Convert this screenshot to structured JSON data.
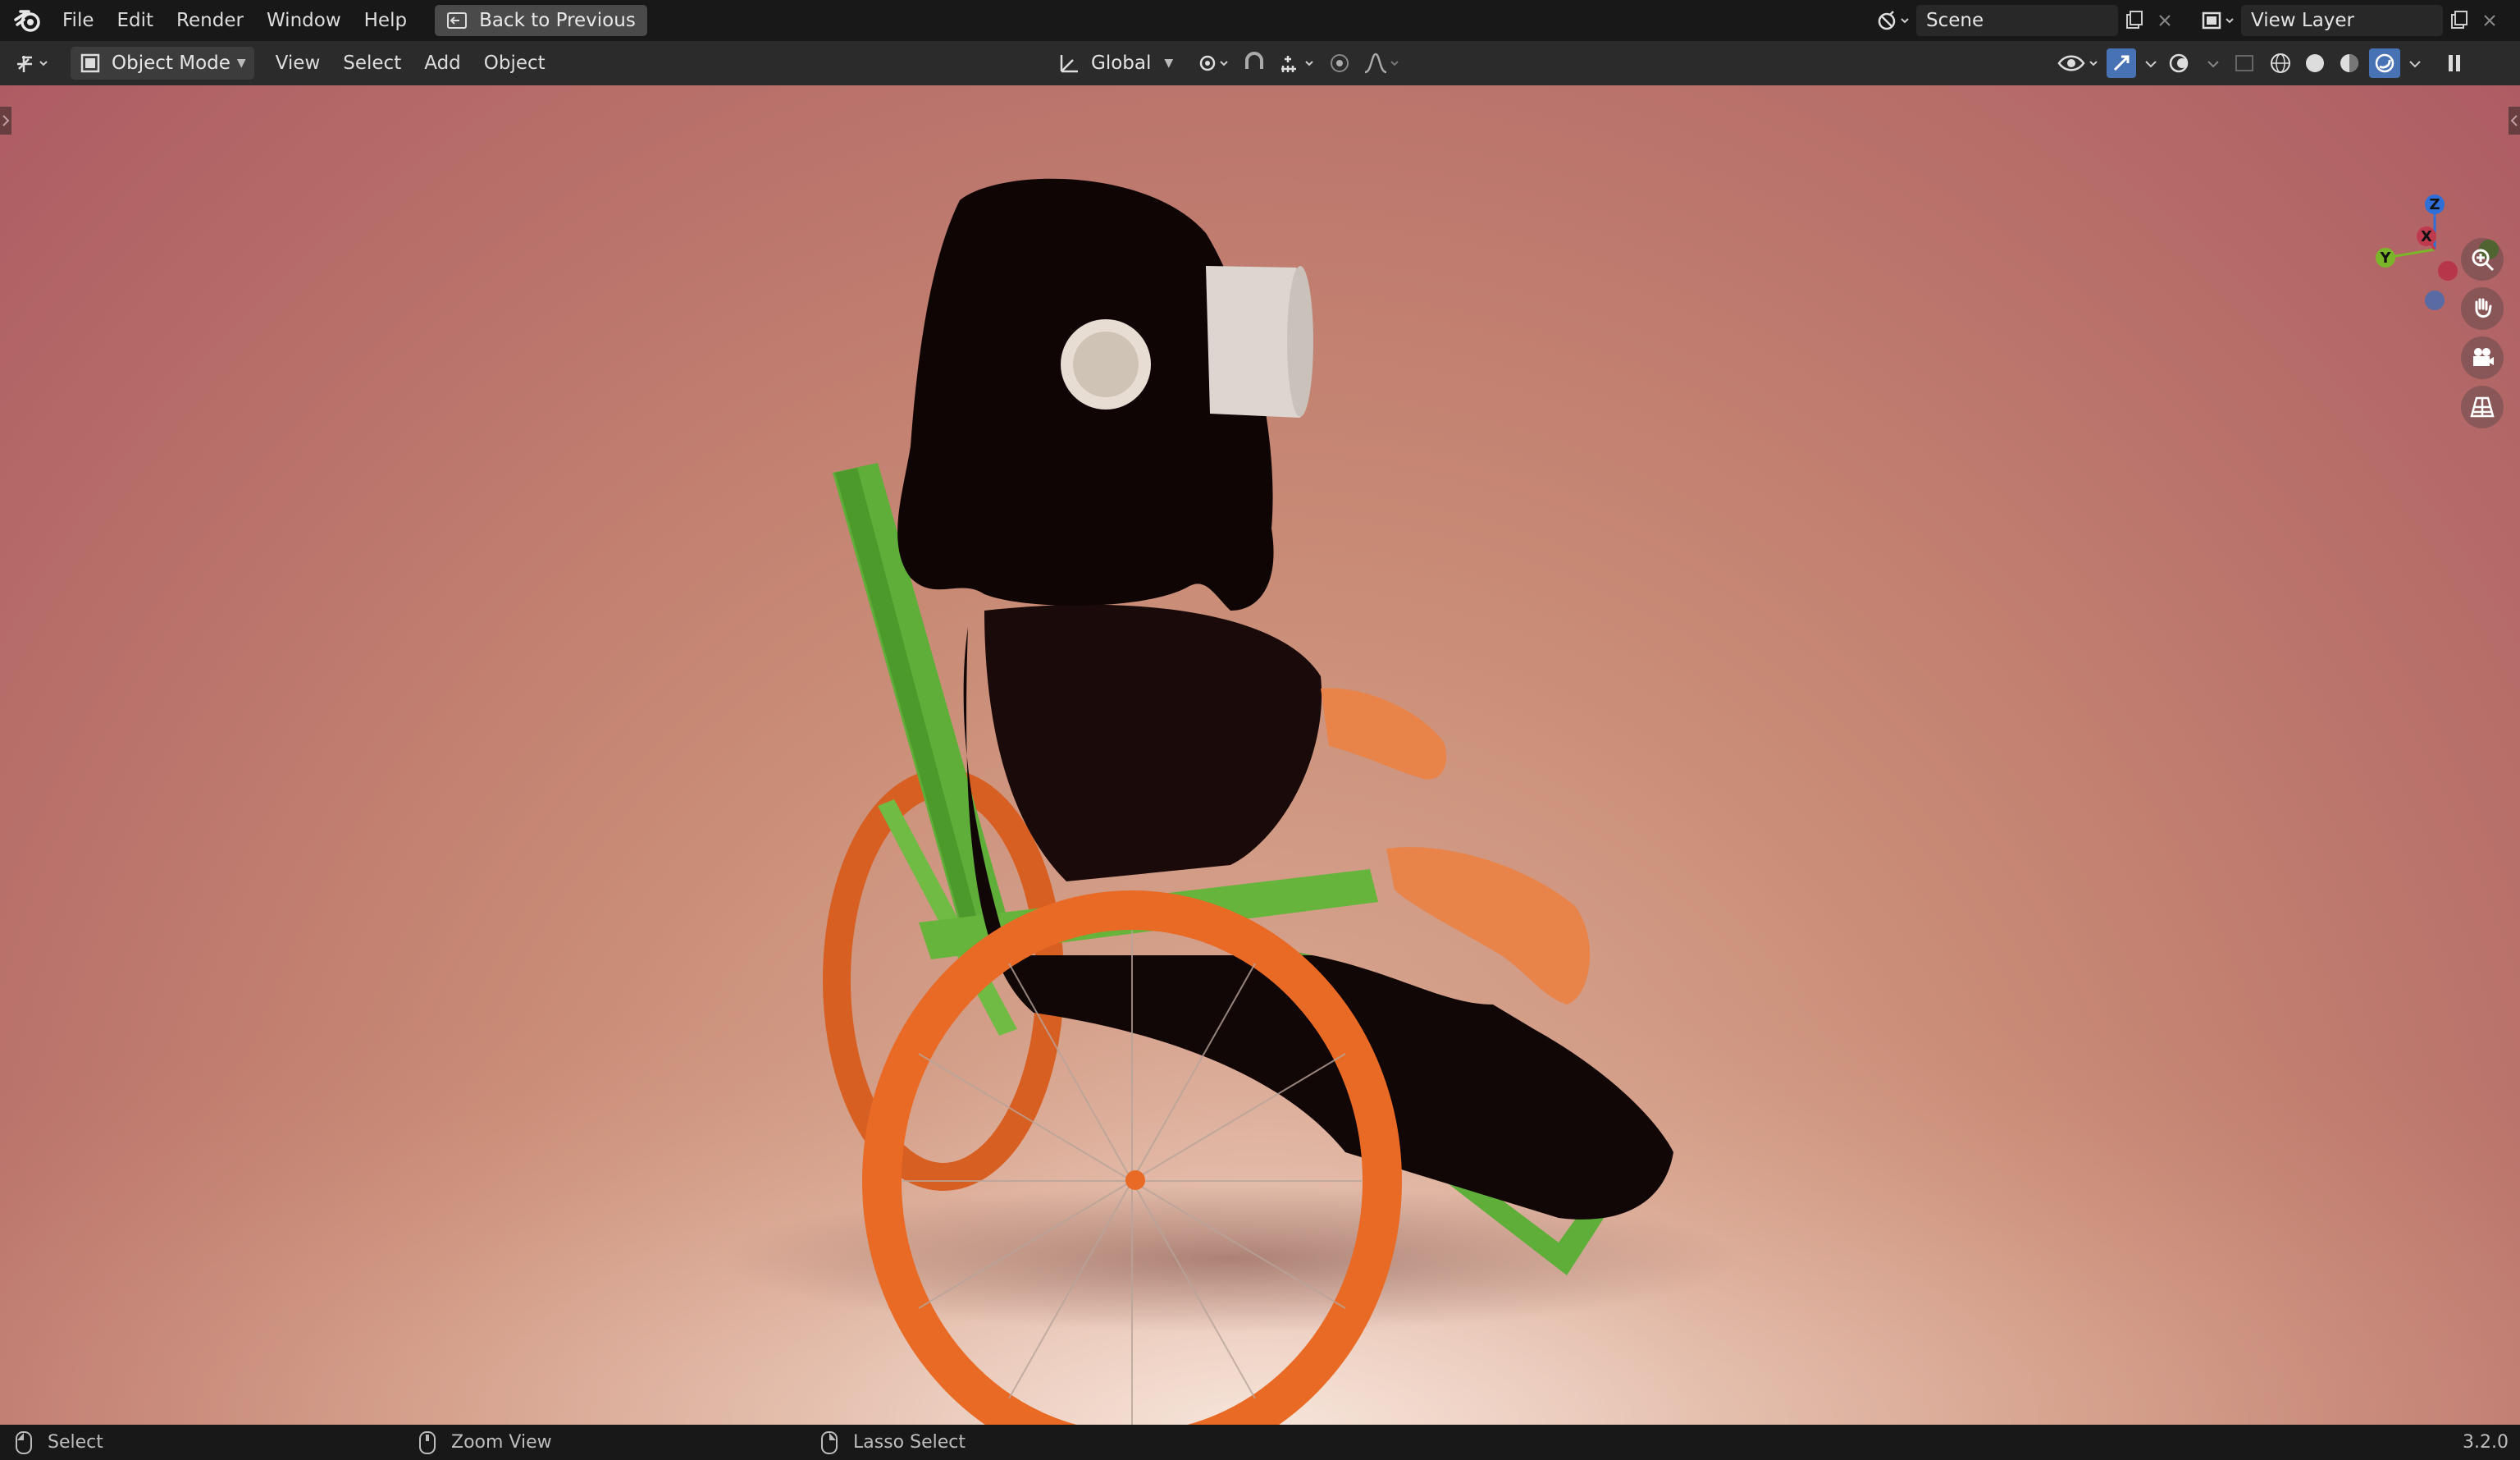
{
  "topbar": {
    "menus": [
      "File",
      "Edit",
      "Render",
      "Window",
      "Help"
    ],
    "back_button": "Back to Previous",
    "scene": "Scene",
    "view_layer": "View Layer"
  },
  "header": {
    "mode": "Object Mode",
    "menus": [
      "View",
      "Select",
      "Add",
      "Object"
    ],
    "orientation": "Global"
  },
  "gizmo": {
    "z": "Z",
    "x": "X",
    "y": "Y"
  },
  "statusbar": {
    "select": "Select",
    "zoom": "Zoom View",
    "lasso": "Lasso Select",
    "version": "3.2.0"
  },
  "colors": {
    "accent": "#4772b3",
    "chair_green": "#5fae3a",
    "wheel_orange": "#e86a25"
  }
}
